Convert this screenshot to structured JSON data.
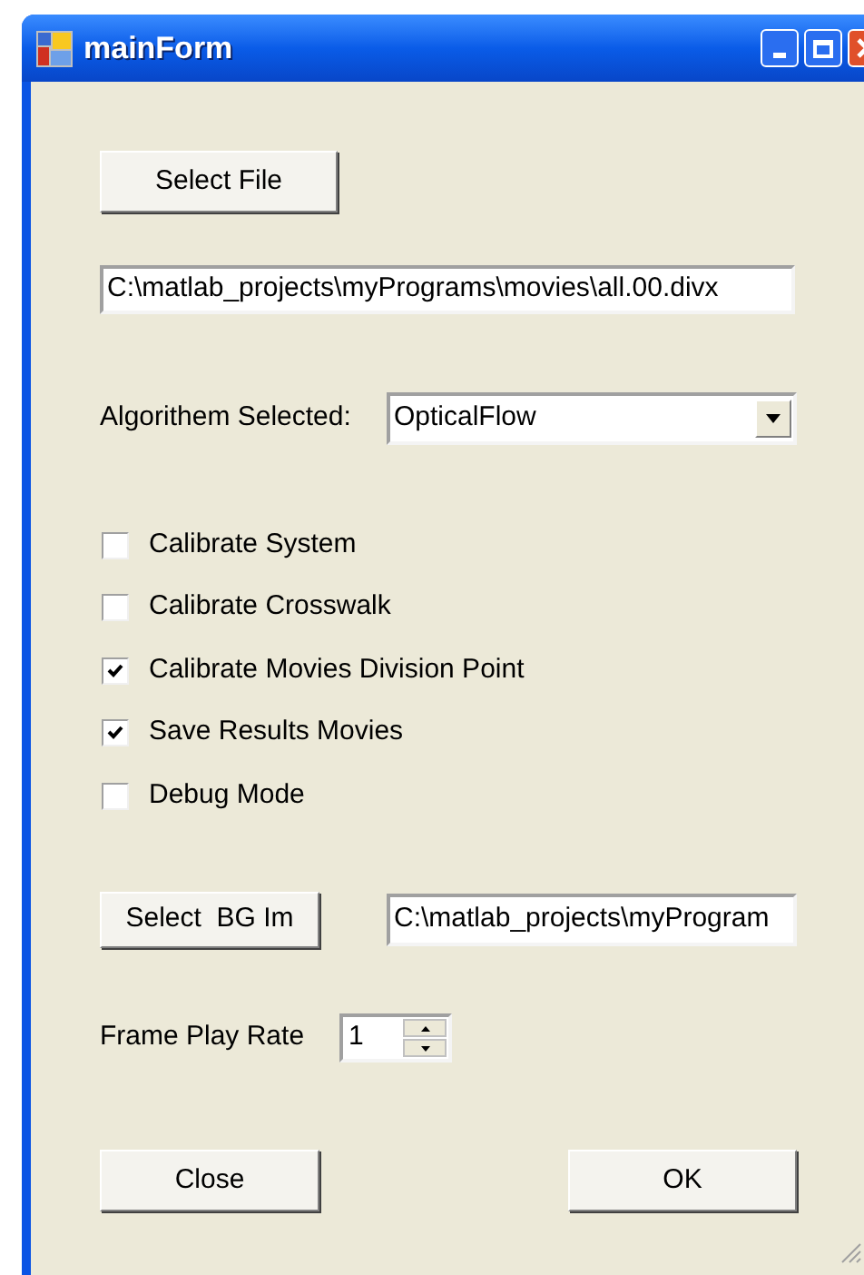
{
  "window": {
    "title": "mainForm"
  },
  "select_file_button": "Select File",
  "file_path": "C:\\matlab_projects\\myPrograms\\movies\\all.00.divx",
  "algorithm": {
    "label": "Algorithem Selected:",
    "value": "OpticalFlow"
  },
  "options": [
    {
      "label": "Calibrate System",
      "checked": false
    },
    {
      "label": "Calibrate Crosswalk",
      "checked": false
    },
    {
      "label": "Calibrate Movies Division Point",
      "checked": true
    },
    {
      "label": "Save Results Movies",
      "checked": true
    },
    {
      "label": "Debug Mode",
      "checked": false
    }
  ],
  "background_image": {
    "button": "Select  BG Im",
    "path": "C:\\matlab_projects\\myProgram"
  },
  "frame_play_rate": {
    "label": "Frame Play Rate",
    "value": "1"
  },
  "buttons": [
    "Close",
    "OK"
  ]
}
